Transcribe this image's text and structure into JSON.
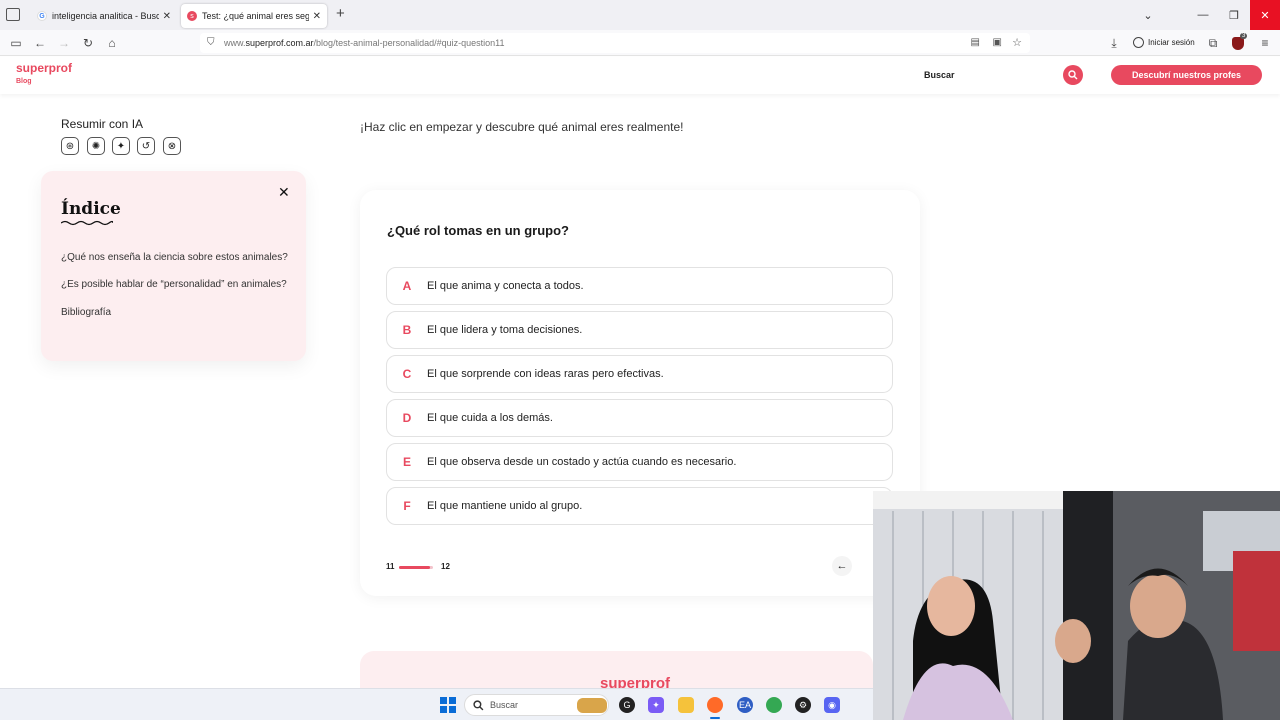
{
  "browser": {
    "tabs": [
      {
        "title": "inteligencia analitica - Buscar co",
        "icon": "google-icon",
        "active": false
      },
      {
        "title": "Test: ¿qué animal eres según tu",
        "icon": "superprof-icon",
        "active": true
      }
    ],
    "new_tab": "+",
    "url_prefix": "www.",
    "url_domain": "superprof.com.ar",
    "url_path": "/blog/test-animal-personalidad/#quiz-question11",
    "signin_label": "Iniciar sesión",
    "extension_badge": "3"
  },
  "site": {
    "logo": "superprof",
    "logo_sub": "Blog",
    "search_label": "Buscar",
    "cta_label": "Descubrí nuestros profes",
    "accent": "#e8495f"
  },
  "summary": {
    "title": "Resumir con IA",
    "icons": [
      "chatgpt-icon",
      "claude-icon",
      "gemini-icon",
      "perplexity-icon",
      "grok-icon"
    ]
  },
  "index": {
    "title": "Índice",
    "close": "✕",
    "items": [
      "¿Qué nos enseña la ciencia sobre estos animales?",
      "¿Es posible hablar de “personalidad” en animales?",
      "Bibliografía"
    ]
  },
  "intro": "¡Haz clic en empezar y descubre qué animal eres realmente!",
  "quiz": {
    "question": "¿Qué rol tomas en un grupo?",
    "options": [
      {
        "letter": "A",
        "text": "El que anima y conecta a todos."
      },
      {
        "letter": "B",
        "text": "El que lidera y toma decisiones."
      },
      {
        "letter": "C",
        "text": "El que sorprende con ideas raras pero efectivas."
      },
      {
        "letter": "D",
        "text": "El que cuida a los demás."
      },
      {
        "letter": "E",
        "text": "El que observa desde un costado y actúa cuando es necesario."
      },
      {
        "letter": "F",
        "text": "El que mantiene unido al grupo."
      }
    ],
    "current": "11",
    "total": "12",
    "progress": 0.9167,
    "back_icon": "←"
  },
  "footer_logo": "superprof",
  "taskbar": {
    "search_label": "Buscar"
  }
}
